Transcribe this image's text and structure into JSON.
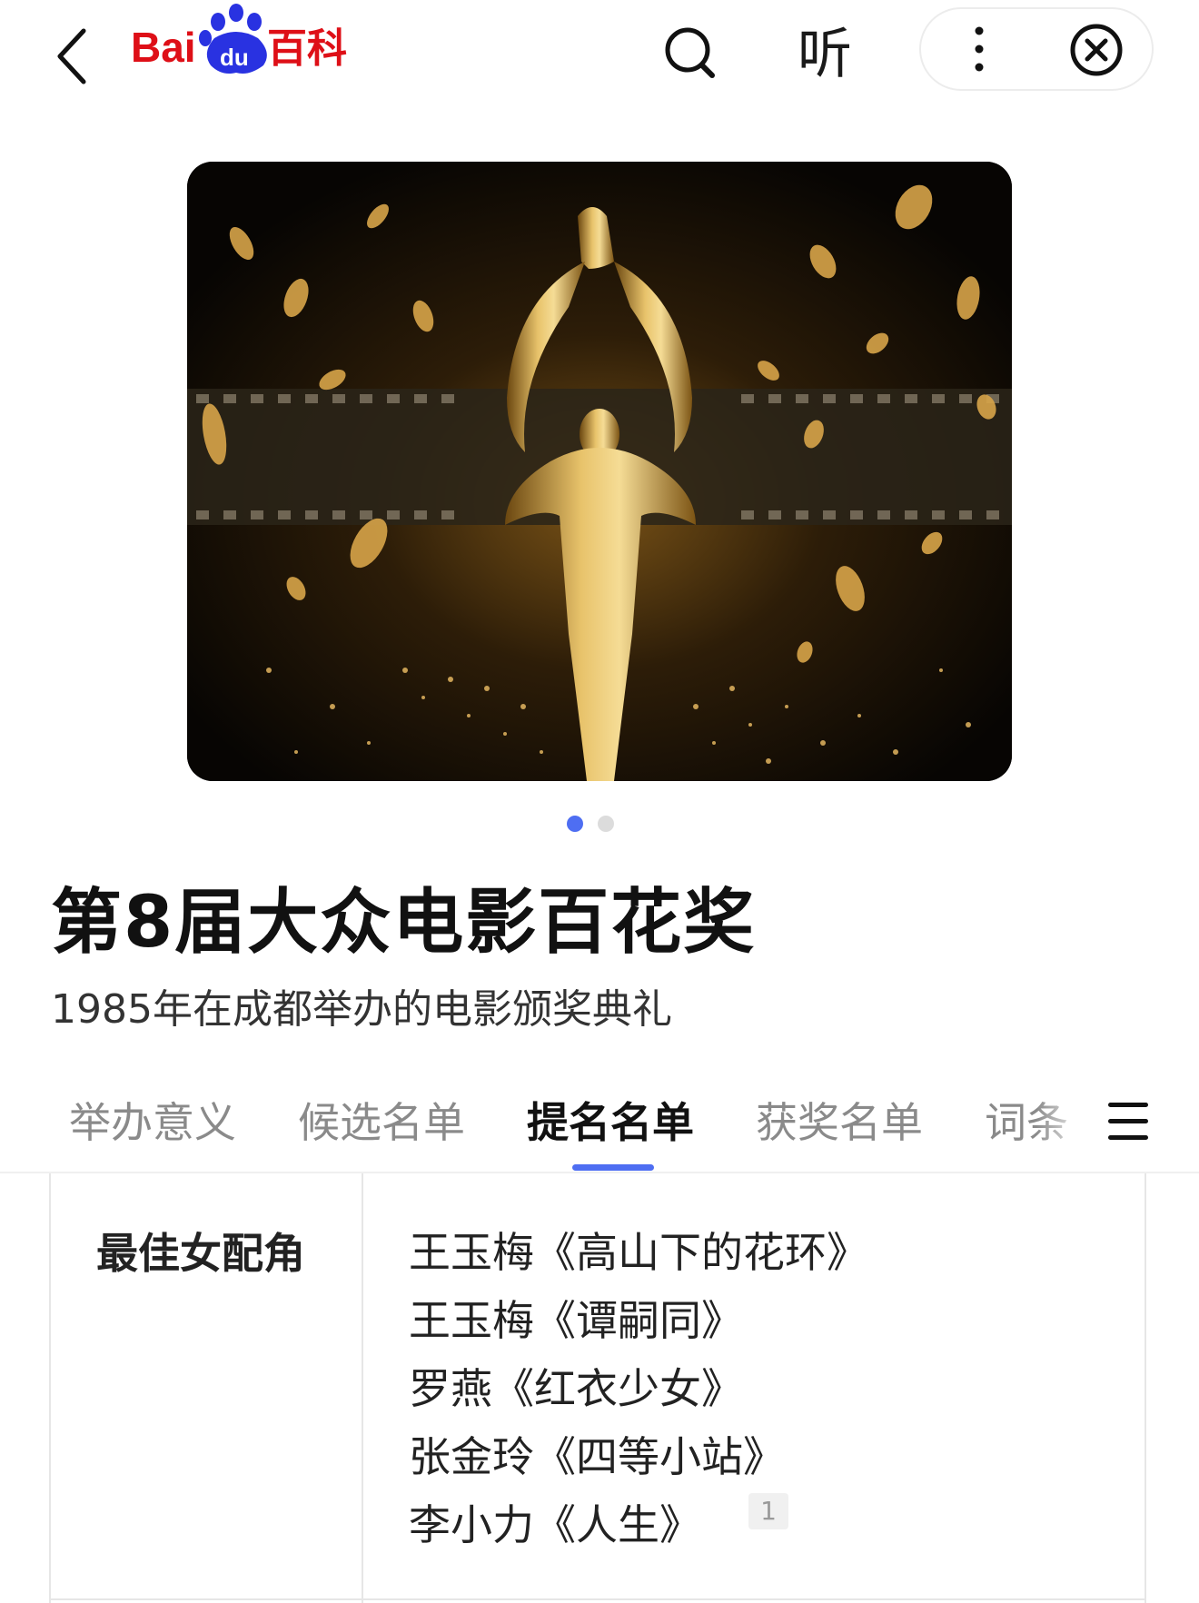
{
  "header": {
    "logo_text": "Bai du 百科",
    "listen_label": "听",
    "icons": [
      "back-arrow-icon",
      "baidu-paw-icon",
      "search-icon",
      "more-vertical-icon",
      "close-circle-icon"
    ]
  },
  "carousel": {
    "image_alt": "百花奖奖杯",
    "current_index": 1,
    "total": 2,
    "active_dot_color": "#4e6ef2",
    "inactive_dot_color": "#dcdcdc"
  },
  "entry": {
    "title": "第8届大众电影百花奖",
    "subtitle": "1985年在成都举办的电影颁奖典礼"
  },
  "tabs": [
    {
      "label": "举办意义",
      "active": false
    },
    {
      "label": "候选名单",
      "active": false
    },
    {
      "label": "提名名单",
      "active": true
    },
    {
      "label": "获奖名单",
      "active": false
    },
    {
      "label": "词条",
      "active": false
    }
  ],
  "nominations": {
    "category": "最佳女配角",
    "items": [
      "王玉梅《高山下的花环》",
      "王玉梅《谭嗣同》",
      "罗燕《红衣少女》",
      "张金玲《四等小站》",
      "李小力《人生》"
    ],
    "reference": "1"
  },
  "colors": {
    "brand_red": "#de0f17",
    "brand_blue": "#2932e1",
    "accent": "#4e6ef2"
  }
}
